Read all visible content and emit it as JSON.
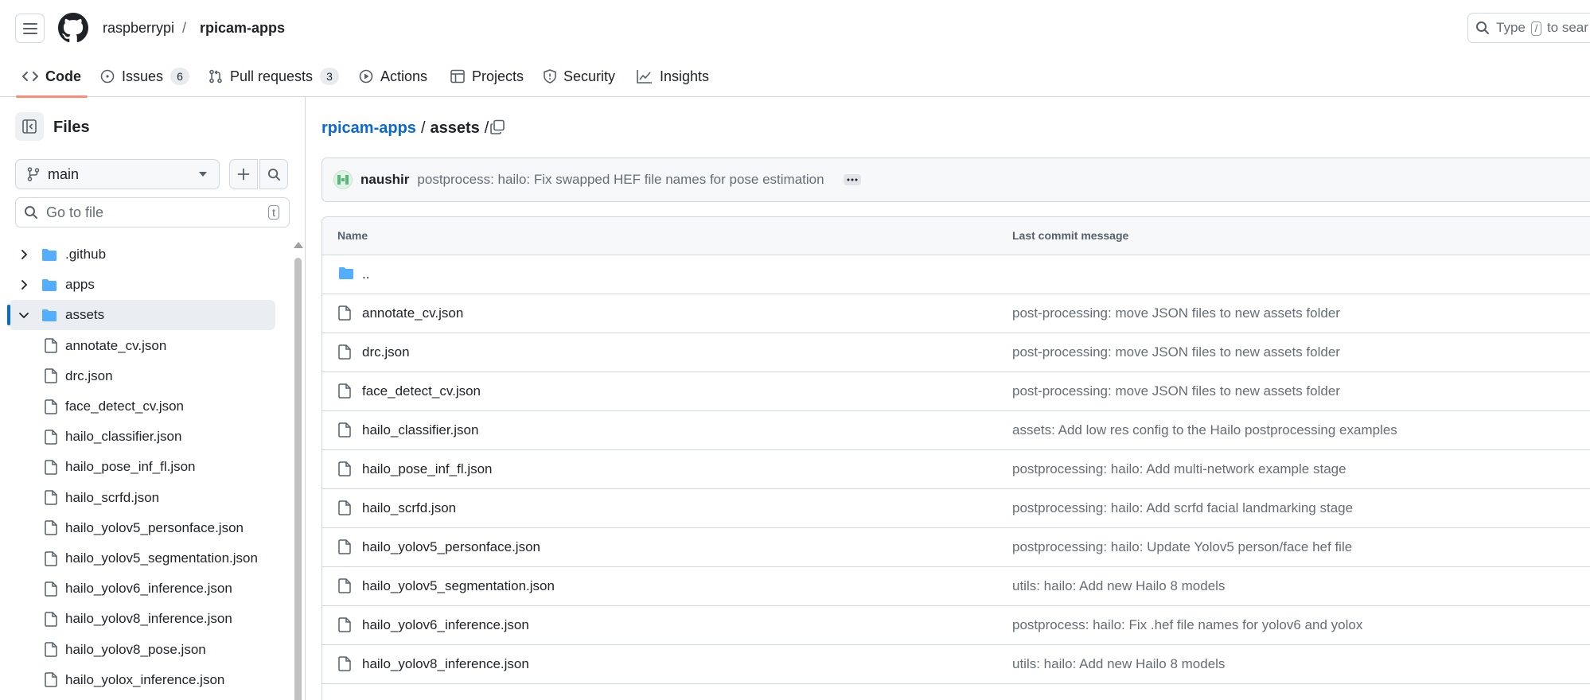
{
  "header": {
    "owner": "raspberrypi",
    "separator": "/",
    "repo": "rpicam-apps",
    "search_prefix": "Type",
    "search_key": "/",
    "search_suffix": "to sear"
  },
  "nav": {
    "tabs": [
      {
        "label": "Code",
        "active": true
      },
      {
        "label": "Issues",
        "count": "6"
      },
      {
        "label": "Pull requests",
        "count": "3"
      },
      {
        "label": "Actions"
      },
      {
        "label": "Projects"
      },
      {
        "label": "Security"
      },
      {
        "label": "Insights"
      }
    ]
  },
  "sidebar": {
    "title": "Files",
    "branch": "main",
    "goto_placeholder": "Go to file",
    "goto_shortcut": "t",
    "tree": [
      {
        "name": ".github",
        "type": "folder",
        "expanded": false
      },
      {
        "name": "apps",
        "type": "folder",
        "expanded": false
      },
      {
        "name": "assets",
        "type": "folder",
        "expanded": true,
        "selected": true
      },
      {
        "name": "annotate_cv.json",
        "type": "file"
      },
      {
        "name": "drc.json",
        "type": "file"
      },
      {
        "name": "face_detect_cv.json",
        "type": "file"
      },
      {
        "name": "hailo_classifier.json",
        "type": "file"
      },
      {
        "name": "hailo_pose_inf_fl.json",
        "type": "file"
      },
      {
        "name": "hailo_scrfd.json",
        "type": "file"
      },
      {
        "name": "hailo_yolov5_personface.json",
        "type": "file"
      },
      {
        "name": "hailo_yolov5_segmentation.json",
        "type": "file"
      },
      {
        "name": "hailo_yolov6_inference.json",
        "type": "file"
      },
      {
        "name": "hailo_yolov8_inference.json",
        "type": "file"
      },
      {
        "name": "hailo_yolov8_pose.json",
        "type": "file"
      },
      {
        "name": "hailo_yolox_inference.json",
        "type": "file"
      }
    ]
  },
  "main": {
    "path_repo": "rpicam-apps",
    "path_sep": "/",
    "path_dir": "assets",
    "path_trail": "/",
    "latest_commit": {
      "author": "naushir",
      "message": "postprocess: hailo: Fix swapped HEF file names for pose estimation"
    },
    "table": {
      "col_name": "Name",
      "col_message": "Last commit message",
      "parent": "..",
      "rows": [
        {
          "name": "annotate_cv.json",
          "message": "post-processing: move JSON files to new assets folder"
        },
        {
          "name": "drc.json",
          "message": "post-processing: move JSON files to new assets folder"
        },
        {
          "name": "face_detect_cv.json",
          "message": "post-processing: move JSON files to new assets folder"
        },
        {
          "name": "hailo_classifier.json",
          "message": "assets: Add low res config to the Hailo postprocessing examples"
        },
        {
          "name": "hailo_pose_inf_fl.json",
          "message": "postprocessing: hailo: Add multi-network example stage"
        },
        {
          "name": "hailo_scrfd.json",
          "message": "postprocessing: hailo: Add scrfd facial landmarking stage"
        },
        {
          "name": "hailo_yolov5_personface.json",
          "message": "postprocessing: hailo: Update Yolov5 person/face hef file"
        },
        {
          "name": "hailo_yolov5_segmentation.json",
          "message": "utils: hailo: Add new Hailo 8 models"
        },
        {
          "name": "hailo_yolov6_inference.json",
          "message": "postprocess: hailo: Fix .hef file names for yolov6 and yolox"
        },
        {
          "name": "hailo_yolov8_inference.json",
          "message": "utils: hailo: Add new Hailo 8 models"
        }
      ]
    }
  },
  "colors": {
    "link": "#0969da",
    "folder": "#54aeff",
    "active_tab_underline": "#fd8c73",
    "border": "#d0d7de"
  }
}
